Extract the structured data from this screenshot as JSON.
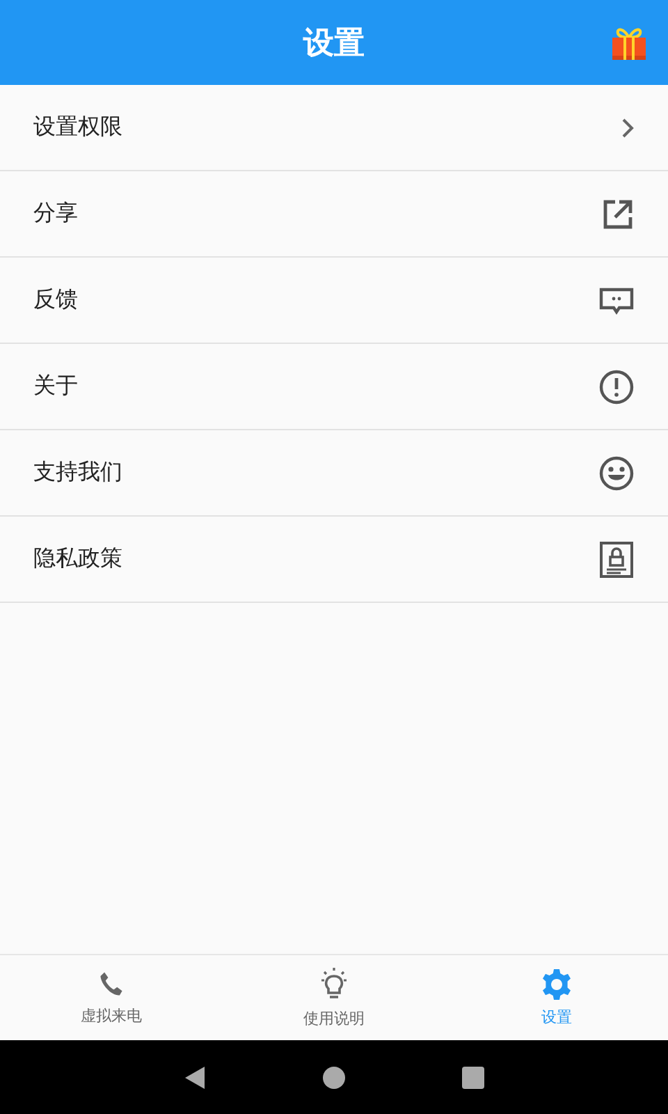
{
  "header": {
    "title": "设置"
  },
  "items": [
    {
      "label": "设置权限",
      "kind": "chevron"
    },
    {
      "label": "分享",
      "kind": "share"
    },
    {
      "label": "反馈",
      "kind": "feedback"
    },
    {
      "label": "关于",
      "kind": "info"
    },
    {
      "label": "支持我们",
      "kind": "smile"
    },
    {
      "label": "隐私政策",
      "kind": "privacy"
    }
  ],
  "tabs": [
    {
      "label": "虚拟来电",
      "kind": "phone",
      "selected": false
    },
    {
      "label": "使用说明",
      "kind": "bulb",
      "selected": false
    },
    {
      "label": "设置",
      "kind": "gear",
      "selected": true
    }
  ]
}
